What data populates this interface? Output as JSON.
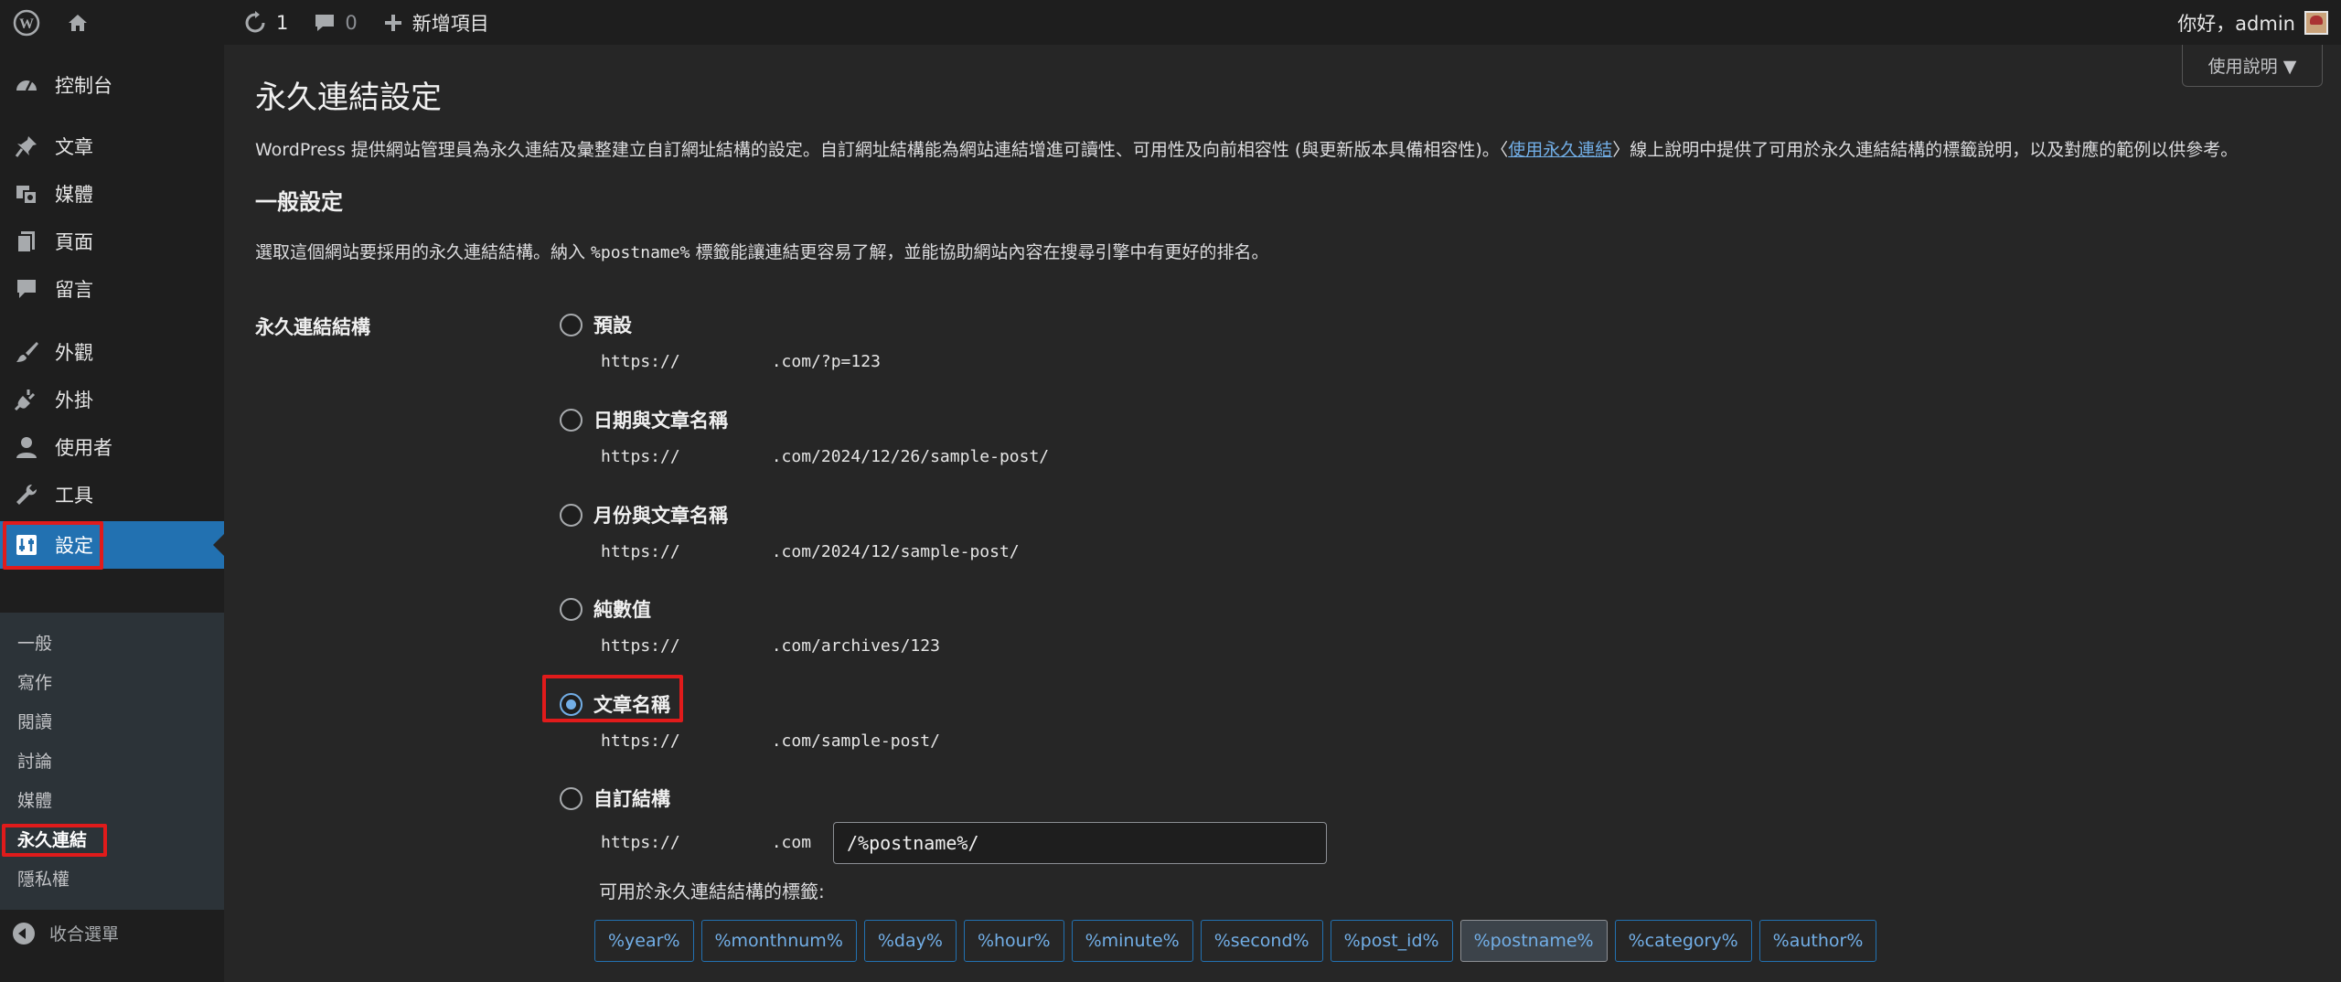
{
  "adminbar": {
    "updates_count": "1",
    "comments_count": "0",
    "new_label": "新增項目",
    "greeting": "你好，admin"
  },
  "help_tab": {
    "label": "使用說明 ▼"
  },
  "sidebar": {
    "items": [
      {
        "label": "控制台",
        "icon": "dashboard-icon"
      },
      {
        "label": "文章",
        "icon": "pin-icon"
      },
      {
        "label": "媒體",
        "icon": "media-icon"
      },
      {
        "label": "頁面",
        "icon": "page-icon"
      },
      {
        "label": "留言",
        "icon": "comment-icon"
      },
      {
        "label": "外觀",
        "icon": "brush-icon"
      },
      {
        "label": "外掛",
        "icon": "plugin-icon"
      },
      {
        "label": "使用者",
        "icon": "user-icon"
      },
      {
        "label": "工具",
        "icon": "wrench-icon"
      },
      {
        "label": "設定",
        "icon": "settings-icon"
      }
    ],
    "submenu": [
      "一般",
      "寫作",
      "閱讀",
      "討論",
      "媒體",
      "永久連結",
      "隱私權"
    ],
    "collapse_label": "收合選單"
  },
  "main": {
    "title": "永久連結設定",
    "intro_before": "WordPress 提供網站管理員為永久連結及彙整建立自訂網址結構的設定。自訂網址結構能為網站連結增進可讀性、可用性及向前相容性 (與更新版本具備相容性)。〈",
    "intro_link": "使用永久連結",
    "intro_after": "〉線上說明中提供了可用於永久連結結構的標籤說明，以及對應的範例以供參考。",
    "general_heading": "一般設定",
    "desc_before": "選取這個網站要採用的永久連結結構。納入 ",
    "desc_code": "%postname%",
    "desc_after": " 標籤能讓連結更容易了解，並能協助網站內容在搜尋引擎中有更好的排名。",
    "row_label": "永久連結結構",
    "url_prefix": "https://",
    "options": [
      {
        "label": "預設",
        "url_suffix": ".com/?p=123",
        "checked": false
      },
      {
        "label": "日期與文章名稱",
        "url_suffix": ".com/2024/12/26/sample-post/",
        "checked": false
      },
      {
        "label": "月份與文章名稱",
        "url_suffix": ".com/2024/12/sample-post/",
        "checked": false
      },
      {
        "label": "純數值",
        "url_suffix": ".com/archives/123",
        "checked": false
      },
      {
        "label": "文章名稱",
        "url_suffix": ".com/sample-post/",
        "checked": true
      },
      {
        "label": "自訂結構",
        "url_suffix": ".com",
        "checked": false
      }
    ],
    "custom_value": "/%postname%/",
    "tags_label": "可用於永久連結結構的標籤:",
    "tags": [
      "%year%",
      "%monthnum%",
      "%day%",
      "%hour%",
      "%minute%",
      "%second%",
      "%post_id%",
      "%postname%",
      "%category%",
      "%author%"
    ],
    "active_tag": "%postname%"
  },
  "colors": {
    "accent": "#2271b1",
    "link": "#72aee6",
    "highlight": "#e01b1b"
  }
}
